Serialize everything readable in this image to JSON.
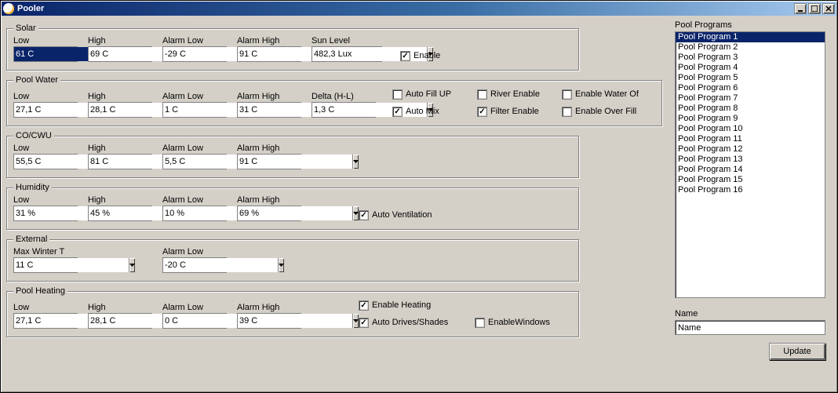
{
  "window": {
    "title": "Pooler"
  },
  "groups": {
    "solar": {
      "title": "Solar",
      "fields": {
        "low": {
          "label": "Low",
          "value": "61 C"
        },
        "high": {
          "label": "High",
          "value": "69 C"
        },
        "alarmLow": {
          "label": "Alarm Low",
          "value": "-29 C"
        },
        "alarmHigh": {
          "label": "Alarm High",
          "value": "91 C"
        },
        "sunLevel": {
          "label": "Sun Level",
          "value": "482,3 Lux"
        }
      },
      "checks": {
        "enable": {
          "label": "Enable",
          "checked": true
        }
      }
    },
    "poolWater": {
      "title": "Pool Water",
      "fields": {
        "low": {
          "label": "Low",
          "value": "27,1 C"
        },
        "high": {
          "label": "High",
          "value": "28,1 C"
        },
        "alarmLow": {
          "label": "Alarm Low",
          "value": "1 C"
        },
        "alarmHigh": {
          "label": "Alarm High",
          "value": "31 C"
        },
        "delta": {
          "label": "Delta (H-L)",
          "value": "1,3 C"
        }
      },
      "checks": {
        "autoFill": {
          "label": "Auto Fill UP",
          "checked": false
        },
        "autoMix": {
          "label": "Auto Mix",
          "checked": true
        },
        "riverEnable": {
          "label": "River Enable",
          "checked": false
        },
        "filterEnable": {
          "label": "Filter Enable",
          "checked": true
        },
        "enableWaterOf": {
          "label": "Enable Water Of",
          "checked": false
        },
        "enableOverFill": {
          "label": "Enable Over Fill",
          "checked": false
        }
      }
    },
    "coCwu": {
      "title": "CO/CWU",
      "fields": {
        "low": {
          "label": "Low",
          "value": "55,5 C"
        },
        "high": {
          "label": "High",
          "value": "81 C"
        },
        "alarmLow": {
          "label": "Alarm Low",
          "value": "5,5 C"
        },
        "alarmHigh": {
          "label": "Alarm High",
          "value": "91 C"
        }
      }
    },
    "humidity": {
      "title": "Humidity",
      "fields": {
        "low": {
          "label": "Low",
          "value": "31 %"
        },
        "high": {
          "label": "High",
          "value": "45 %"
        },
        "alarmLow": {
          "label": "Alarm Low",
          "value": "10 %"
        },
        "alarmHigh": {
          "label": "Alarm High",
          "value": "69 %"
        }
      },
      "checks": {
        "autoVent": {
          "label": "Auto Ventilation",
          "checked": true
        }
      }
    },
    "external": {
      "title": "External",
      "fields": {
        "maxWinterT": {
          "label": "Max Winter T",
          "value": "11 C"
        },
        "alarmLow": {
          "label": "Alarm Low",
          "value": "-20 C"
        }
      }
    },
    "poolHeating": {
      "title": "Pool Heating",
      "fields": {
        "low": {
          "label": "Low",
          "value": "27,1 C"
        },
        "high": {
          "label": "High",
          "value": "28,1 C"
        },
        "alarmLow": {
          "label": "Alarm Low",
          "value": "0 C"
        },
        "alarmHigh": {
          "label": "Alarm High",
          "value": "39 C"
        }
      },
      "checks": {
        "enableHeating": {
          "label": "Enable Heating",
          "checked": true
        },
        "autoDrivesShades": {
          "label": "Auto Drives/Shades",
          "checked": true
        },
        "enableWindows": {
          "label": "EnableWindows",
          "checked": false
        }
      }
    }
  },
  "programs": {
    "title": "Pool Programs",
    "selectedIndex": 0,
    "items": [
      "Pool Program 1",
      "Pool Program 2",
      "Pool Program 3",
      "Pool Program 4",
      "Pool Program 5",
      "Pool Program 6",
      "Pool Program 7",
      "Pool Program 8",
      "Pool Program 9",
      "Pool Program 10",
      "Pool Program 11",
      "Pool Program 12",
      "Pool Program 13",
      "Pool Program 14",
      "Pool Program 15",
      "Pool Program 16"
    ]
  },
  "nameField": {
    "label": "Name",
    "value": "Name"
  },
  "buttons": {
    "update": "Update"
  }
}
